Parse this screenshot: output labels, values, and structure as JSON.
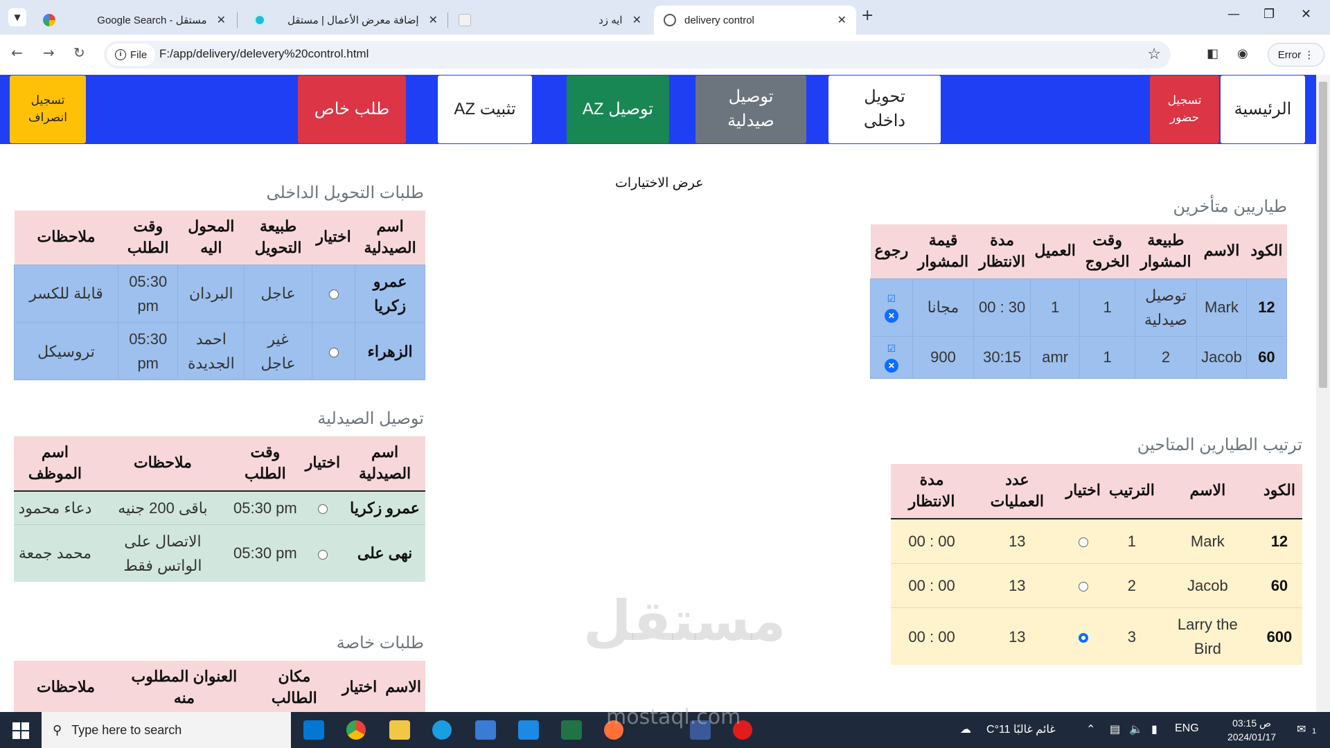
{
  "browser": {
    "tabs": [
      {
        "title": "Google Search - مستقل",
        "active": false
      },
      {
        "title": "إضافة معرض الأعمال | مستقل",
        "active": false
      },
      {
        "title": "ايه زد",
        "active": false
      },
      {
        "title": "delivery control",
        "active": true
      }
    ],
    "address": {
      "chip": "File",
      "url": "F:/app/delivery/delevery%20control.html"
    },
    "error_chip": "Error"
  },
  "navbar": {
    "home": "الرئيسية",
    "checkin": "تسجيل حضور",
    "internal_transfer": "تحويل داخلى",
    "pharmacy_delivery": "توصيل صيدلية",
    "az_delivery": "توصيل AZ",
    "az_install": "تثبيت AZ",
    "special_request": "طلب خاص",
    "checkout": "تسجيل انصراف"
  },
  "center_note": "عرض الاختيارات",
  "late_pilots": {
    "title": "طياريين متأخرين",
    "headers": [
      "الكود",
      "الاسم",
      "طبيعة المشوار",
      "وقت الخروج",
      "العميل",
      "مدة الانتظار",
      "قيمة المشوار",
      "رجوع"
    ],
    "rows": [
      {
        "code": "12",
        "name": "Mark",
        "nature": "توصيل صيدلية",
        "exit_time": "1",
        "client": "1",
        "wait": "00 : 30",
        "value": "مجانا"
      },
      {
        "code": "60",
        "name": "Jacob",
        "nature": "2",
        "exit_time": "1",
        "client": "amr",
        "wait": "30:15",
        "value": "900"
      }
    ]
  },
  "available_pilots": {
    "title": "ترتيب الطيارين المتاحين",
    "headers": [
      "الكود",
      "الاسم",
      "الترتيب",
      "اختيار",
      "عدد العمليات",
      "مدة الانتظار"
    ],
    "rows": [
      {
        "code": "12",
        "name": "Mark",
        "order": "1",
        "selected": false,
        "ops": "13",
        "wait": "00 : 00"
      },
      {
        "code": "60",
        "name": "Jacob",
        "order": "2",
        "selected": false,
        "ops": "13",
        "wait": "00 : 00"
      },
      {
        "code": "600",
        "name": "Larry the Bird",
        "order": "3",
        "selected": true,
        "ops": "13",
        "wait": "00 : 00"
      }
    ]
  },
  "internal_requests": {
    "title": "طلبات التحويل الداخلى",
    "headers": [
      "اسم الصيدلية",
      "اختيار",
      "طبيعة التحويل",
      "المحول اليه",
      "وقت الطلب",
      "ملاحظات"
    ],
    "rows": [
      {
        "pharmacy": "عمرو زكريا",
        "type": "عاجل",
        "to": "البردان",
        "time": "05:30 pm",
        "notes": "قابلة للكسر"
      },
      {
        "pharmacy": "الزهراء",
        "type": "غير عاجل",
        "to": "احمد الجديدة",
        "time": "05:30 pm",
        "notes": "تروسيكل"
      }
    ]
  },
  "pharmacy_delivery": {
    "title": "توصيل الصيدلية",
    "headers": [
      "اسم الصيدلية",
      "اختيار",
      "وقت الطلب",
      "ملاحظات",
      "اسم الموظف"
    ],
    "rows": [
      {
        "pharmacy": "عمرو زكريا",
        "time": "05:30 pm",
        "notes": "باقى 200 جنيه",
        "employee": "دعاء محمود"
      },
      {
        "pharmacy": "نهى على",
        "time": "05:30 pm",
        "notes": "الاتصال على الواتس فقط",
        "employee": "محمد جمعة"
      }
    ]
  },
  "special_requests": {
    "title": "طلبات خاصة",
    "headers": [
      "الاسم",
      "اختيار",
      "مكان الطالب",
      "العنوان المطلوب منه",
      "ملاحظات"
    ]
  },
  "watermark": {
    "text": "مستقل",
    "sub": "mostaql.com"
  },
  "taskbar": {
    "search_placeholder": "Type here to search",
    "weather": "غائم غالبًا  11°C",
    "lang": "ENG",
    "time": "03:15 ص",
    "date": "2024/01/17",
    "notif_count": "1"
  },
  "colors": {
    "navbar": "#1f3ff5",
    "header_pink": "#f8d7da",
    "row_blue": "#9ec0ee",
    "row_green": "#d1e7dd",
    "row_cream": "#fff3cd"
  }
}
